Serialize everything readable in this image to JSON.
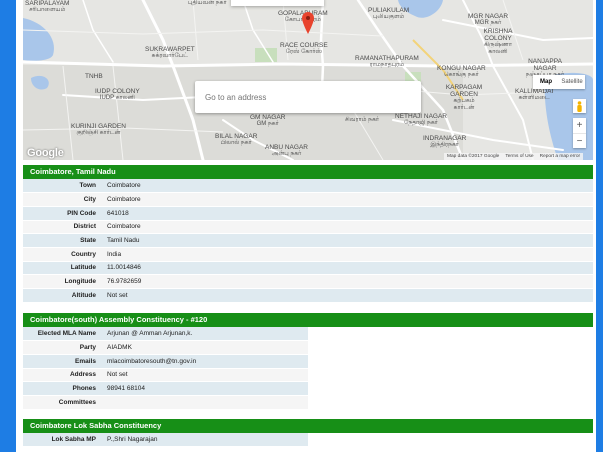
{
  "map": {
    "search_placeholder": "Go to an address",
    "type_map": "Map",
    "type_satellite": "Satellite",
    "zoom_in": "+",
    "zoom_out": "−",
    "logo": "Google",
    "attribution": {
      "data": "Map data ©2017 Google",
      "terms": "Terms of Use",
      "report": "Report a map error"
    },
    "labels": [
      {
        "en": "SARIPALAYAM",
        "ta": "சரிபாளையம்"
      },
      {
        "en": "",
        "ta": "புதியவன் நகர்"
      },
      {
        "en": "GOPALAPURAM",
        "ta": "கோபாலபுரம்"
      },
      {
        "en": "PULIAKULAM",
        "ta": "புலியகுளம்"
      },
      {
        "en": "MGR NAGAR",
        "ta": "MGR நகர்"
      },
      {
        "en": "KRISHNA COLONY",
        "ta": "கிருஷ்ணா காலனி"
      },
      {
        "en": "SUKRAWARPET",
        "ta": "சுக்ரவார்பேட்"
      },
      {
        "en": "RACE COURSE",
        "ta": "ரேஸ் கோர்ஸ்"
      },
      {
        "en": "RAMANATHAPURAM",
        "ta": "ராமநாதபுரம்"
      },
      {
        "en": "KONGU NAGAR",
        "ta": "கொங்கு நகர்"
      },
      {
        "en": "NANJAPPA NAGAR",
        "ta": "நஞ்சப்பா நகர்"
      },
      {
        "en": "TNHB",
        "ta": ""
      },
      {
        "en": "IUDP COLONY",
        "ta": "IUDP காலனி"
      },
      {
        "en": "KARPAGAM GARDEN",
        "ta": "கற்பகம் கார்டன்"
      },
      {
        "en": "KALLIMADAI",
        "ta": "கள்ளிமடை"
      },
      {
        "en": "KURINJI GARDEN",
        "ta": "குறிஞ்சி கார்டன்"
      },
      {
        "en": "GM NAGAR",
        "ta": "GM நகர்"
      },
      {
        "en": "",
        "ta": "சிவராம் நகர்"
      },
      {
        "en": "NETHAJI NAGAR",
        "ta": "நேதாஜி நகர்"
      },
      {
        "en": "BILAL NAGAR",
        "ta": "பிலால் நகர்"
      },
      {
        "en": "ANBU NAGAR",
        "ta": "அன்பு நகர்"
      },
      {
        "en": "INDRANAGAR",
        "ta": "இந்திரநகர்"
      }
    ],
    "colors": {
      "water": "#a9c6ea",
      "road": "#ffffff",
      "land": "#e6e6e3",
      "pin": "#e8432d"
    }
  },
  "location": {
    "title": "Coimbatore, Tamil Nadu",
    "rows": [
      {
        "label": "Town",
        "value": "Coimbatore",
        "style": "plain"
      },
      {
        "label": "City",
        "value": "Coimbatore",
        "style": "plain"
      },
      {
        "label": "PIN Code",
        "value": "641018",
        "style": "plain"
      },
      {
        "label": "District",
        "value": "Coimbatore",
        "style": "link"
      },
      {
        "label": "State",
        "value": "Tamil Nadu",
        "style": "link"
      },
      {
        "label": "Country",
        "value": "India",
        "style": "plain"
      },
      {
        "label": "Latitude",
        "value": "11.0014846",
        "style": "plain"
      },
      {
        "label": "Longitude",
        "value": "76.9782659",
        "style": "plain"
      },
      {
        "label": "Altitude",
        "value": "Not set",
        "style": "muted"
      }
    ]
  },
  "assembly": {
    "title": "Coimbatore(south) Assembly Constituency - #120",
    "rows": [
      {
        "label": "Elected MLA Name",
        "value": "Arjunan @ Amman Arjunan,k.",
        "style": "plain"
      },
      {
        "label": "Party",
        "value": "AIADMK",
        "style": "plain"
      },
      {
        "label": "Emails",
        "value": "mlacoimbatoresouth@tn.gov.in",
        "style": "link"
      },
      {
        "label": "Address",
        "value": "Not set",
        "style": "muted"
      },
      {
        "label": "Phones",
        "value": "98941 68104",
        "style": "link"
      },
      {
        "label": "Committees",
        "value": "",
        "style": "plain"
      }
    ]
  },
  "lok_sabha": {
    "title": "Coimbatore Lok Sabha Constituency",
    "rows": [
      {
        "label": "Lok Sabha MP",
        "value": "P.,Shri Nagarajan",
        "style": "plain"
      }
    ]
  },
  "theme": {
    "header_green": "#178f17",
    "frame_blue": "#1e7de4",
    "row_blue": "#dfeaf0",
    "row_grey": "#f5f5f5",
    "link": "#2b6cb0",
    "muted": "#f29b9b"
  }
}
